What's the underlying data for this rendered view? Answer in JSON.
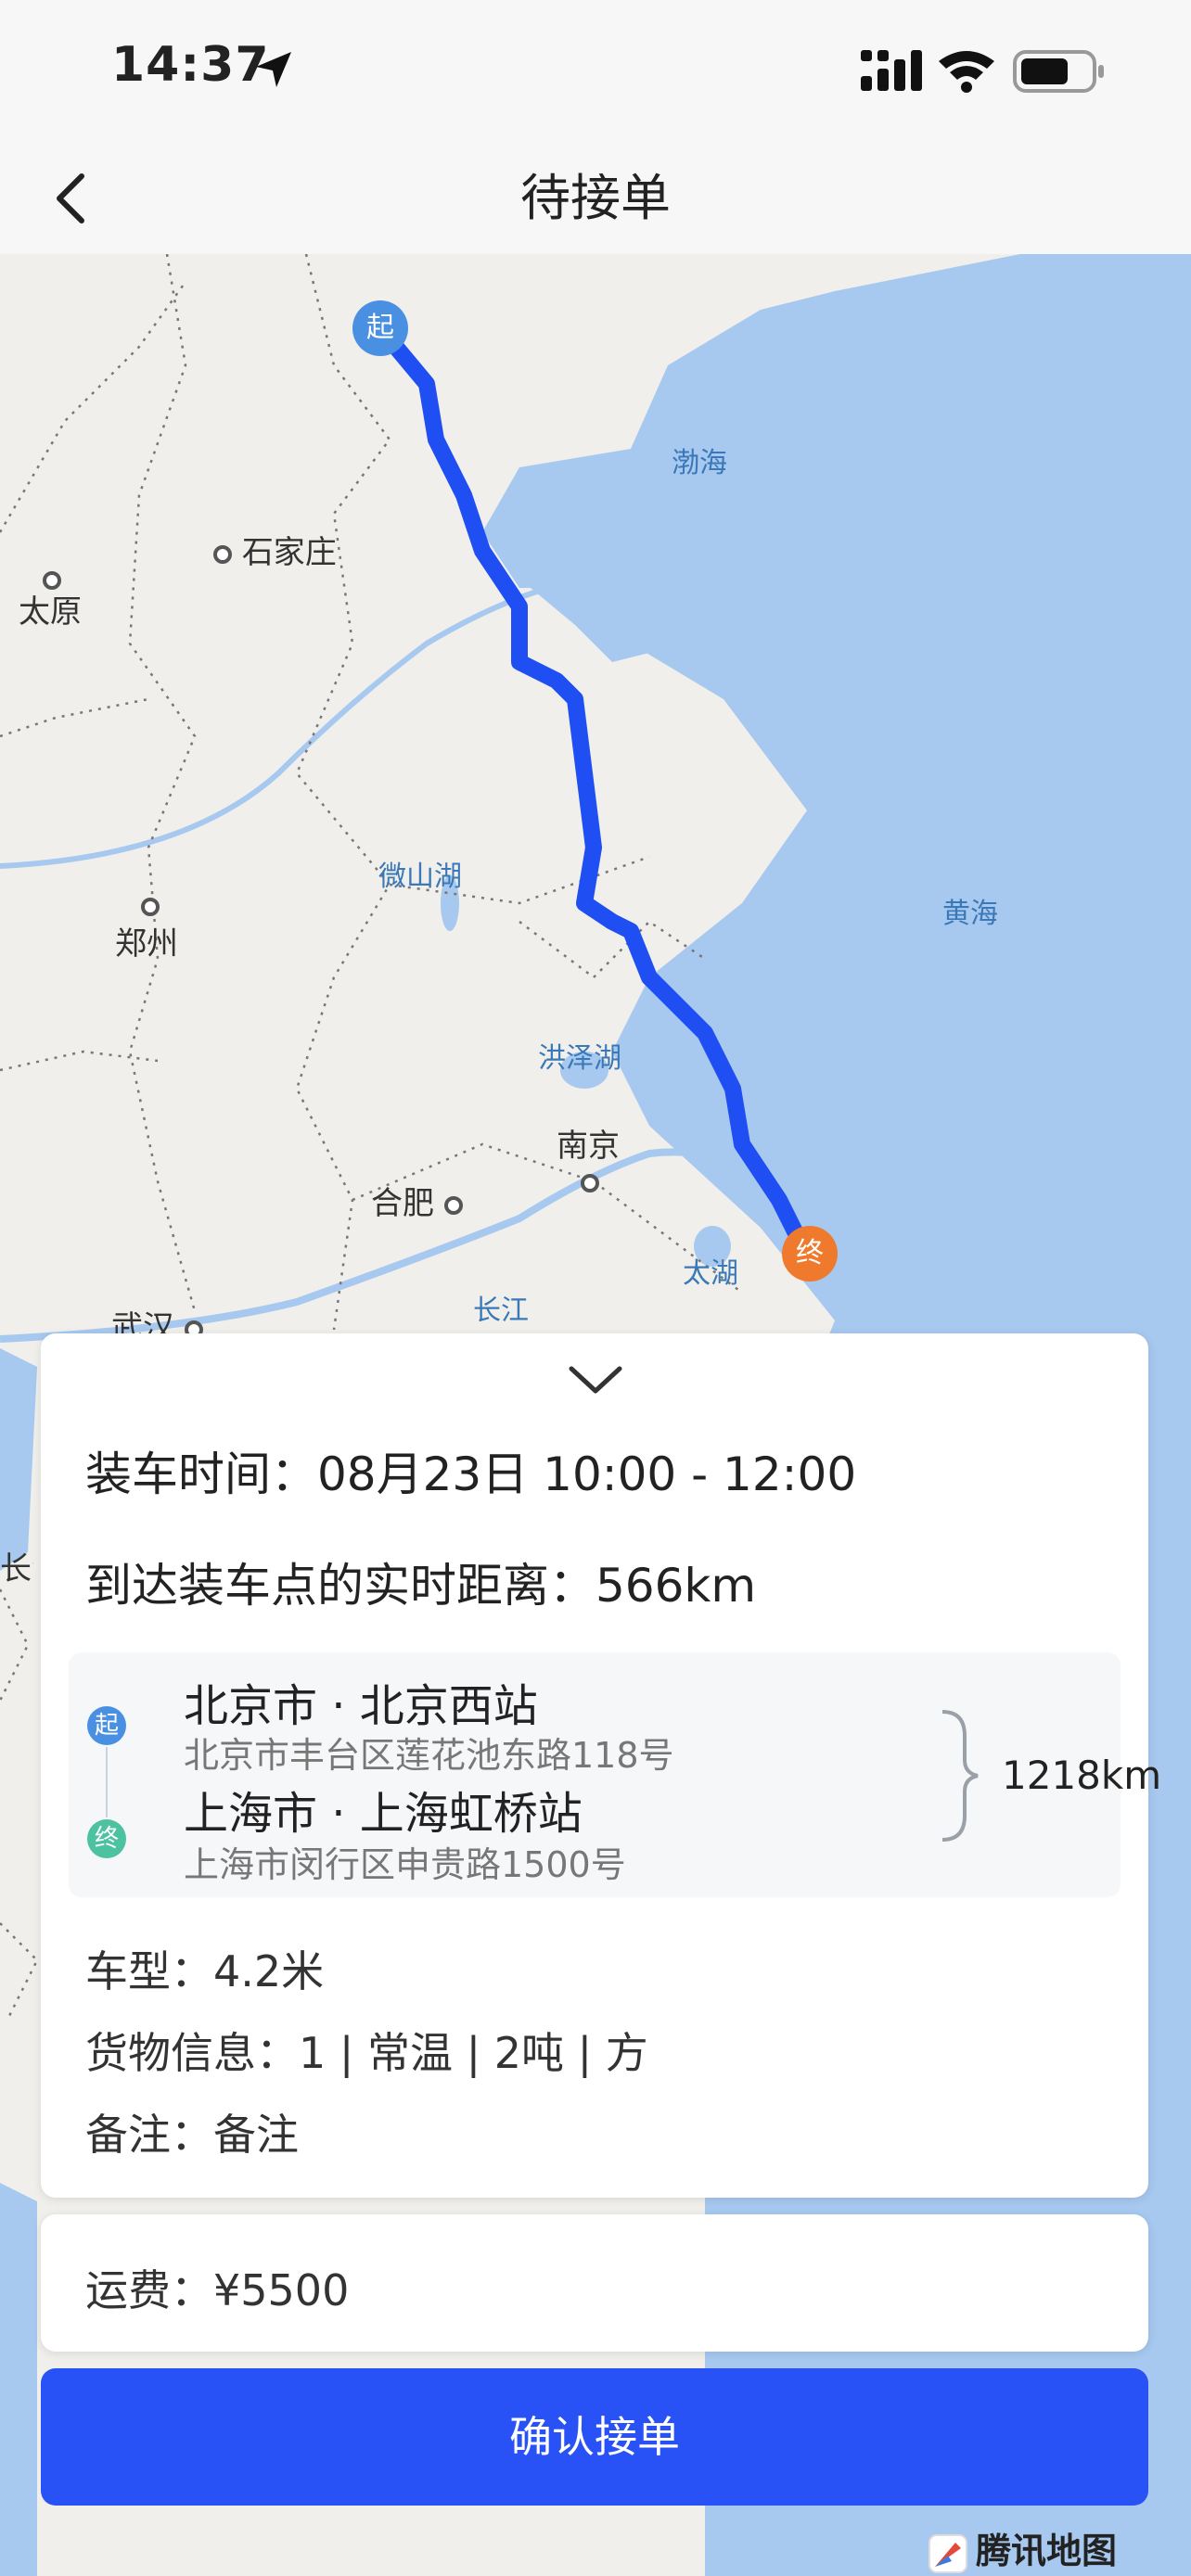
{
  "status_bar": {
    "time": "14:37"
  },
  "nav": {
    "title": "待接单"
  },
  "map": {
    "labels": {
      "bohai": "渤海",
      "shijiazhuang": "石家庄",
      "taiyuan": "太原",
      "weishanhu": "微山湖",
      "zhengzhou": "郑州",
      "huanghai": "黄海",
      "hongzehu": "洪泽湖",
      "nanjing": "南京",
      "hefei": "合肥",
      "taihu": "太湖",
      "changjiang": "长江",
      "wuhan": "武汉",
      "chang_edge": "长江"
    },
    "start_pin": "起",
    "end_pin": "终",
    "provider": "腾讯地图",
    "colors": {
      "route": "#1f4ff2",
      "start": "#4a90e2",
      "end": "#ef7a2d",
      "sea": "#a7c8ef",
      "land": "#f0efeb"
    }
  },
  "order": {
    "load_time_label": "装车时间：",
    "load_time_value": "08月23日 10:00 - 12:00",
    "realtime_distance_label": "到达装车点的实时距离：",
    "realtime_distance_value": "566km",
    "route": {
      "start_badge": "起",
      "start_name": "北京市 · 北京西站",
      "start_address": "北京市丰台区莲花池东路118号",
      "end_badge": "终",
      "end_name": "上海市 · 上海虹桥站",
      "end_address": "上海市闵行区申贵路1500号",
      "distance": "1218km"
    },
    "vehicle_label": "车型：",
    "vehicle_value": "4.2米",
    "cargo_label": "货物信息：",
    "cargo_value": "1 | 常温 | 2吨 | 方",
    "remark_label": "备注：",
    "remark_value": "备注",
    "fee_label": "运费：",
    "fee_value": "¥5500"
  },
  "actions": {
    "confirm_label": "确认接单"
  }
}
